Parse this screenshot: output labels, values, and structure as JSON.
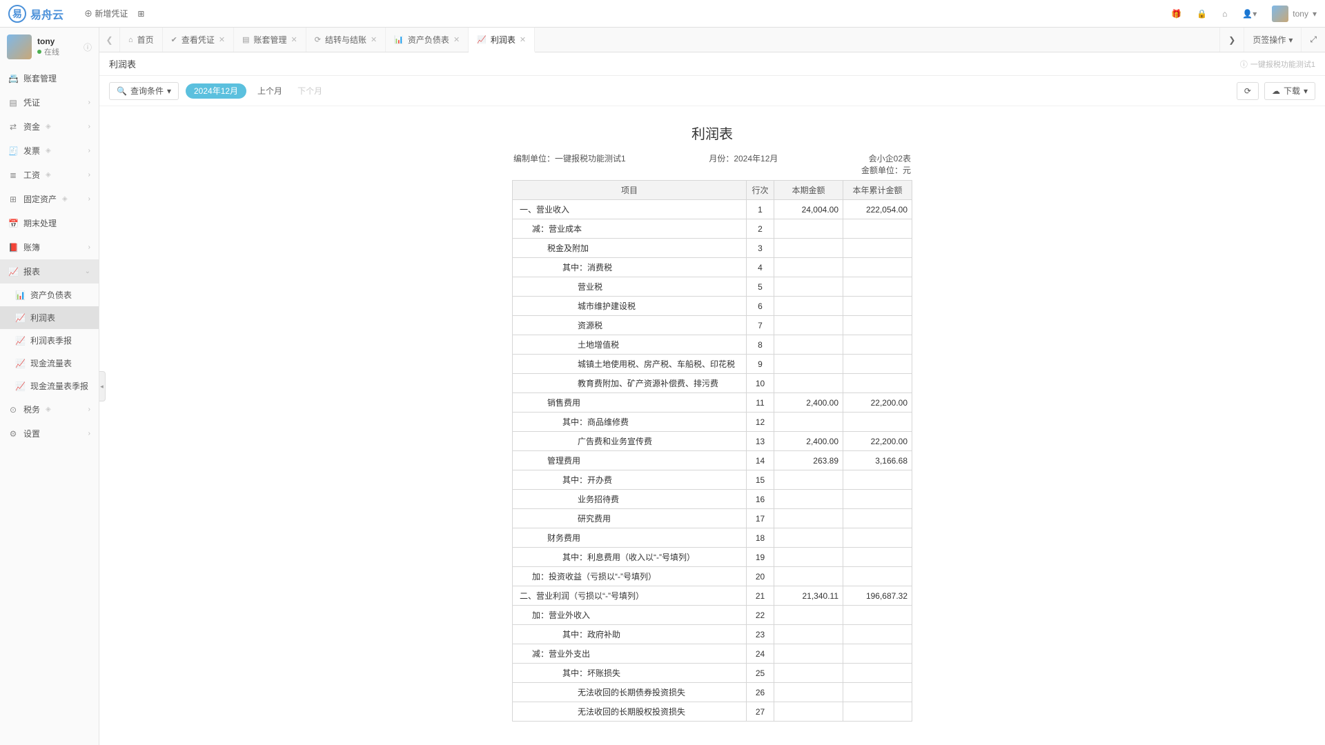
{
  "app": {
    "name": "易舟云"
  },
  "header": {
    "new_voucher": "新增凭证",
    "user": "tony"
  },
  "sidebar": {
    "user": {
      "name": "tony",
      "status": "在线"
    },
    "items": [
      {
        "icon": "📇",
        "label": "账套管理",
        "expandable": false
      },
      {
        "icon": "▤",
        "label": "凭证",
        "expandable": true
      },
      {
        "icon": "⇄",
        "label": "资金",
        "diamond": true,
        "expandable": true
      },
      {
        "icon": "🧾",
        "label": "发票",
        "diamond": true,
        "expandable": true
      },
      {
        "icon": "≣",
        "label": "工资",
        "diamond": true,
        "expandable": true
      },
      {
        "icon": "⊞",
        "label": "固定资产",
        "diamond": true,
        "expandable": true
      },
      {
        "icon": "📅",
        "label": "期末处理",
        "expandable": false
      },
      {
        "icon": "📕",
        "label": "账簿",
        "expandable": true
      },
      {
        "icon": "📈",
        "label": "报表",
        "expandable": true,
        "expanded": true,
        "children": [
          {
            "icon": "📊",
            "label": "资产负债表"
          },
          {
            "icon": "📈",
            "label": "利润表",
            "active": true
          },
          {
            "icon": "📈",
            "label": "利润表季报"
          },
          {
            "icon": "📈",
            "label": "现金流量表"
          },
          {
            "icon": "📈",
            "label": "现金流量表季报"
          }
        ]
      },
      {
        "icon": "⊙",
        "label": "税务",
        "diamond": true,
        "expandable": true
      },
      {
        "icon": "⚙",
        "label": "设置",
        "expandable": true
      }
    ]
  },
  "tabs": {
    "items": [
      {
        "icon": "⌂",
        "label": "首页",
        "closable": false
      },
      {
        "icon": "✔",
        "label": "查看凭证",
        "closable": true
      },
      {
        "icon": "▤",
        "label": "账套管理",
        "closable": true
      },
      {
        "icon": "⟳",
        "label": "结转与结账",
        "closable": true
      },
      {
        "icon": "📊",
        "label": "资产负债表",
        "closable": true
      },
      {
        "icon": "📈",
        "label": "利润表",
        "closable": true,
        "active": true
      }
    ],
    "ops_label": "页签操作"
  },
  "page": {
    "title": "利润表",
    "right_note": "一键报税功能测试1"
  },
  "toolbar": {
    "query": "查询条件",
    "period": "2024年12月",
    "prev": "上个月",
    "next": "下个月",
    "download": "下载"
  },
  "report": {
    "title": "利润表",
    "unit_label": "编制单位：",
    "unit_value": "一键报税功能测试1",
    "period_label": "月份：",
    "period_value": "2024年12月",
    "form_code": "会小企02表",
    "amount_unit": "金额单位：元",
    "cols": {
      "item": "项目",
      "line": "行次",
      "curr": "本期金额",
      "ytd": "本年累计金额"
    },
    "rows": [
      {
        "item": "一、营业收入",
        "line": "1",
        "curr": "24,004.00",
        "ytd": "222,054.00",
        "indent": 0
      },
      {
        "item": "减：营业成本",
        "line": "2",
        "curr": "",
        "ytd": "",
        "indent": 1
      },
      {
        "item": "税金及附加",
        "line": "3",
        "curr": "",
        "ytd": "",
        "indent": 2
      },
      {
        "item": "其中：消费税",
        "line": "4",
        "curr": "",
        "ytd": "",
        "indent": 3
      },
      {
        "item": "营业税",
        "line": "5",
        "curr": "",
        "ytd": "",
        "indent": 4
      },
      {
        "item": "城市维护建设税",
        "line": "6",
        "curr": "",
        "ytd": "",
        "indent": 4
      },
      {
        "item": "资源税",
        "line": "7",
        "curr": "",
        "ytd": "",
        "indent": 4
      },
      {
        "item": "土地增值税",
        "line": "8",
        "curr": "",
        "ytd": "",
        "indent": 4
      },
      {
        "item": "城镇土地使用税、房产税、车船税、印花税",
        "line": "9",
        "curr": "",
        "ytd": "",
        "indent": 4
      },
      {
        "item": "教育费附加、矿产资源补偿费、排污费",
        "line": "10",
        "curr": "",
        "ytd": "",
        "indent": 4
      },
      {
        "item": "销售费用",
        "line": "11",
        "curr": "2,400.00",
        "ytd": "22,200.00",
        "indent": 2
      },
      {
        "item": "其中：商品维修费",
        "line": "12",
        "curr": "",
        "ytd": "",
        "indent": 3
      },
      {
        "item": "广告费和业务宣传费",
        "line": "13",
        "curr": "2,400.00",
        "ytd": "22,200.00",
        "indent": 4
      },
      {
        "item": "管理费用",
        "line": "14",
        "curr": "263.89",
        "ytd": "3,166.68",
        "indent": 2
      },
      {
        "item": "其中：开办费",
        "line": "15",
        "curr": "",
        "ytd": "",
        "indent": 3
      },
      {
        "item": "业务招待费",
        "line": "16",
        "curr": "",
        "ytd": "",
        "indent": 4
      },
      {
        "item": "研究费用",
        "line": "17",
        "curr": "",
        "ytd": "",
        "indent": 4
      },
      {
        "item": "财务费用",
        "line": "18",
        "curr": "",
        "ytd": "",
        "indent": 2
      },
      {
        "item": "其中：利息费用（收入以“-”号填列）",
        "line": "19",
        "curr": "",
        "ytd": "",
        "indent": 3
      },
      {
        "item": "加：投资收益（亏损以“-”号填列）",
        "line": "20",
        "curr": "",
        "ytd": "",
        "indent": 1
      },
      {
        "item": "二、营业利润（亏损以“-”号填列）",
        "line": "21",
        "curr": "21,340.11",
        "ytd": "196,687.32",
        "indent": 0
      },
      {
        "item": "加：营业外收入",
        "line": "22",
        "curr": "",
        "ytd": "",
        "indent": 1
      },
      {
        "item": "其中：政府补助",
        "line": "23",
        "curr": "",
        "ytd": "",
        "indent": 3
      },
      {
        "item": "减：营业外支出",
        "line": "24",
        "curr": "",
        "ytd": "",
        "indent": 1
      },
      {
        "item": "其中：坏账损失",
        "line": "25",
        "curr": "",
        "ytd": "",
        "indent": 3
      },
      {
        "item": "无法收回的长期债券投资损失",
        "line": "26",
        "curr": "",
        "ytd": "",
        "indent": 4
      },
      {
        "item": "无法收回的长期股权投资损失",
        "line": "27",
        "curr": "",
        "ytd": "",
        "indent": 4
      }
    ]
  }
}
